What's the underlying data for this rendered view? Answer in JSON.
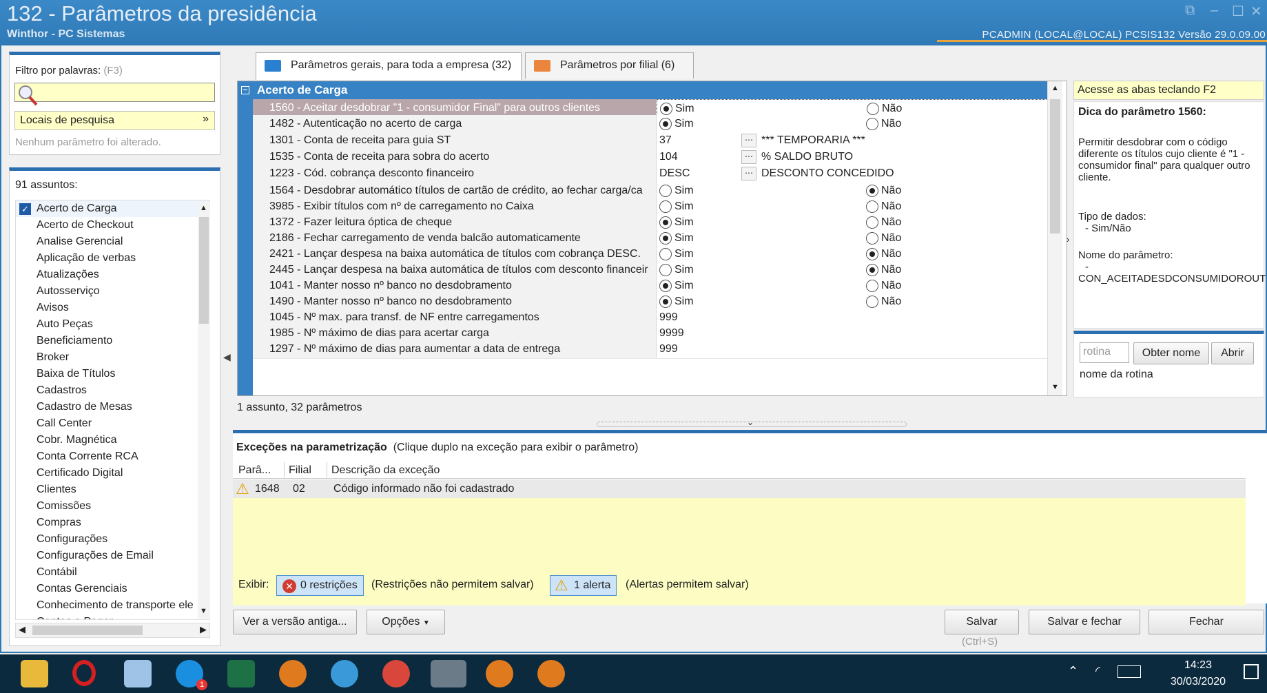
{
  "window": {
    "title": "132 - Parâmetros da presidência",
    "subtitle": "Winthor - PC Sistemas",
    "info": "PCADMIN (LOCAL@LOCAL)  PCSIS132  Versão  29.0.09.00"
  },
  "filter": {
    "label": "Filtro por palavras:",
    "shortcut": "(F3)",
    "search_value": "",
    "locais_label": "Locais de pesquisa",
    "status": "Nenhum parâmetro foi alterado."
  },
  "subjects": {
    "count_label": "91 assuntos:",
    "items": [
      "Acerto de Carga",
      "Acerto de Checkout",
      "Analise Gerencial",
      "Aplicação de verbas",
      "Atualizações",
      "Autosserviço",
      "Avisos",
      "Auto Peças",
      "Beneficiamento",
      "Broker",
      "Baixa de Títulos",
      "Cadastros",
      "Cadastro de Mesas",
      "Call Center",
      "Cobr. Magnética",
      "Conta Corrente RCA",
      "Certificado Digital",
      "Clientes",
      "Comissões",
      "Compras",
      "Configurações",
      "Configurações de Email",
      "Contábil",
      "Contas Gerenciais",
      "Conhecimento de transporte ele",
      "Contas a Pagar"
    ]
  },
  "tabs": [
    {
      "label": "Parâmetros gerais, para toda a empresa  (32)",
      "color": "#2b7fd0"
    },
    {
      "label": "Parâmetros por filial  (6)",
      "color": "#e9853c"
    }
  ],
  "grid": {
    "group_title": "Acerto de Carga",
    "sim_label": "Sim",
    "nao_label": "Não",
    "rows": [
      {
        "name": "1560 - Aceitar desdobrar \"1 - consumidor Final\" para outros clientes",
        "type": "bool",
        "value": "sim"
      },
      {
        "name": "1482 - Autenticação no acerto de carga",
        "type": "bool",
        "value": "sim"
      },
      {
        "name": "1301 - Conta de receita para guia ST",
        "type": "lookup",
        "code": "37",
        "desc": "*** TEMPORARIA ***"
      },
      {
        "name": "1535 - Conta de receita para sobra do acerto",
        "type": "lookup",
        "code": "104",
        "desc": "% SALDO BRUTO"
      },
      {
        "name": "1223 - Cód. cobrança desconto financeiro",
        "type": "lookup",
        "code": "DESC",
        "desc": "DESCONTO CONCEDIDO"
      },
      {
        "name": "1564 - Desdobrar automático títulos de cartão de crédito, ao fechar carga/ca",
        "type": "bool",
        "value": "nao"
      },
      {
        "name": "3985 - Exibir títulos com nº de carregamento no Caixa",
        "type": "bool",
        "value": ""
      },
      {
        "name": "1372 - Fazer leitura óptica de cheque",
        "type": "bool",
        "value": "sim"
      },
      {
        "name": "2186 - Fechar carregamento de venda balcão automaticamente",
        "type": "bool",
        "value": "sim"
      },
      {
        "name": "2421 - Lançar despesa na baixa automática de títulos com cobrança DESC.",
        "type": "bool",
        "value": "nao"
      },
      {
        "name": "2445 - Lançar despesa na baixa automática de títulos com desconto financeir",
        "type": "bool",
        "value": "nao"
      },
      {
        "name": "1041 - Manter nosso nº banco no desdobramento",
        "type": "bool",
        "value": "sim"
      },
      {
        "name": "1490 - Manter nosso nº banco no desdobramento",
        "type": "bool",
        "value": "sim"
      },
      {
        "name": "1045 - Nº max. para transf. de NF entre carregamentos",
        "type": "text",
        "code": "999"
      },
      {
        "name": "1985 - Nº máximo de dias para acertar carga",
        "type": "text",
        "code": "9999"
      },
      {
        "name": "1297 - Nº máximo de dias para aumentar a data de entrega",
        "type": "text",
        "code": "999"
      }
    ],
    "status": "1 assunto, 32 parâmetros"
  },
  "tip": {
    "bar": "Acesse as abas teclando F2",
    "title": "Dica do parâmetro 1560:",
    "desc": "Permitir desdobrar com o código diferente os títulos cujo cliente é \"1 - consumidor final\" para qualquer outro cliente.",
    "type_label": "Tipo de dados:",
    "type_value": "- Sim/Não",
    "name_label": "Nome do parâmetro:",
    "name_dash": "-",
    "name_value": "CON_ACEITADESDCONSUMIDOROUT"
  },
  "rotina": {
    "placeholder": "rotina",
    "obter": "Obter nome",
    "abrir": "Abrir",
    "nome": "nome da rotina"
  },
  "exceptions": {
    "title": "Exceções na parametrização",
    "hint": "(Clique duplo na exceção para exibir o parâmetro)",
    "cols": [
      "Parâ...",
      "Filial",
      "Descrição da exceção"
    ],
    "rows": [
      {
        "param": "1648",
        "filial": "02",
        "desc": "Código informado não foi cadastrado"
      }
    ]
  },
  "exibir": {
    "label": "Exibir:",
    "restr": "0 restrições",
    "restr_hint": "(Restrições não permitem salvar)",
    "alert": "1 alerta",
    "alert_hint": "(Alertas permitem salvar)"
  },
  "buttons": {
    "versao": "Ver a versão antiga...",
    "opcoes": "Opções",
    "salvar": "Salvar",
    "salvar_hint": "(Ctrl+S)",
    "salvar_fechar": "Salvar e fechar",
    "fechar": "Fechar"
  },
  "clock": {
    "time": "14:23",
    "date": "30/03/2020"
  },
  "taskbar": {
    "badge": "1"
  }
}
